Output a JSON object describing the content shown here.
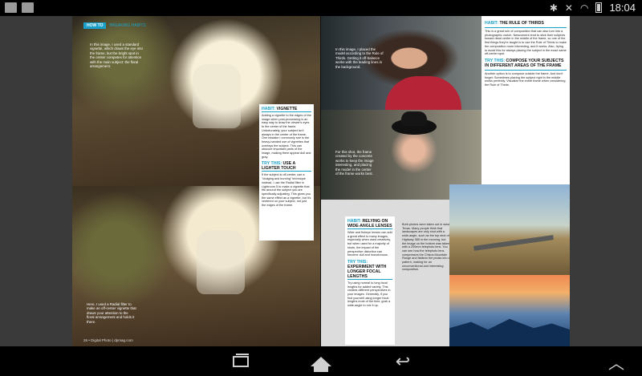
{
  "status_bar": {
    "time": "18:04",
    "left_icons": [
      "gallery-icon",
      "mail-icon"
    ],
    "right_icons": [
      "bluetooth-icon",
      "mute-icon",
      "wifi-icon",
      "battery-icon"
    ]
  },
  "magazine": {
    "left_page": {
      "section_tag": "HOW TO",
      "section_title": "BREAKING HABITS",
      "caption_top": "In this image, I used a standard vignette, which draws the eye into the frame, but the bright spot in the center competes for attention with the main subject: the floral arrangement.",
      "caption_bottom": "Here, I used a Radial filter to make an off-center vignette that draws your attention to the floral arrangement and holds it there.",
      "box": {
        "heading_key": "HABIT:",
        "heading": "VIGNETTE",
        "text": "Adding a vignette to the edges of the image when post-processing is an easy way to draw the viewer's eyes to the center of the frame. Unfortunately, your subject isn't always in the center of the frame. One mistake I commonly see is the heavy-handed use of vignettes that overlays the subject. This can obscure important parts of the image, making them appear dull and gray.",
        "try_key": "TRY THIS:",
        "try_heading": "USE A LIGHTER TOUCH",
        "try_text": "If the subject is off-center, use a \"dodging and burning\" technique instead. I use the Radial filter in Lightroom 5 to make a vignette that fits around the subject you are specifically adjusting. This gives you the same effect as a vignette, but it's centered on your subject, not just the edges of the frame."
      },
      "footer": "26 • Digital Photo | dpmag.com"
    },
    "right_page": {
      "caption_1": "In this image, I placed the model according to the Rule of Thirds. Getting it off-balance works with the leading lines in the background.",
      "caption_2": "For this shot, the frame created by the concrete works to keep the image interesting, and placing the model in the center of the frame works best.",
      "col": {
        "heading_key": "HABIT:",
        "heading": "THE RULE OF THIRDS",
        "text": "This is a great rule of composition that can also turn into a photographic crutch. Newcomers tend to stick their subjects toward dead center in the middle of the frame, so one of the first things they're taught is to use the Rule of Thirds to make the composition more interesting, and it works. Also, trying to avoid this for always placing the subject in the exact same off-center spot.",
        "try_key": "TRY THIS:",
        "try_heading": "COMPOSE YOUR SUBJECTS IN DIFFERENT AREAS OF THE FRAME",
        "try_text": "Another option is to compose outside the frame. And don't forget: Sometimes placing the subject right in the middle works perfectly. Visualize the entire frame when considering the Rule of Thirds."
      },
      "box2": {
        "heading_key": "HABIT:",
        "heading": "RELYING ON WIDE-ANGLE LENSES",
        "text": "Wide and fisheye lenses can add a great effect to many images, especially when used creatively, but when used for a majority of shots, the impact of the perspective distortion can become dull and monotonous.",
        "try_key": "TRY THIS:",
        "try_heading": "EXPERIMENT WITH LONGER FOCAL LENGTHS",
        "try_text": "Try using normal to long focal lengths for added variety. This creates different perspectives in your images. Generally, if you find yourself using longer focal lengths most of the time, grab a wide-angle to mix it up."
      },
      "mid_text": "Both photos were taken out in west Texas. Many people think that landscapes are only shot with a wide-angle, such as the top shot of Highway 385 in the morning, but the image on the bottom was taken with a 200mm telephoto lens. You can see how the telephoto lens compresses the Chisos Mountain Range and flattens the peaks into a pattern, making for an unconventional and interesting composition."
    }
  },
  "nav_bar": {
    "buttons": [
      "recent-apps",
      "home",
      "back",
      "up"
    ]
  }
}
